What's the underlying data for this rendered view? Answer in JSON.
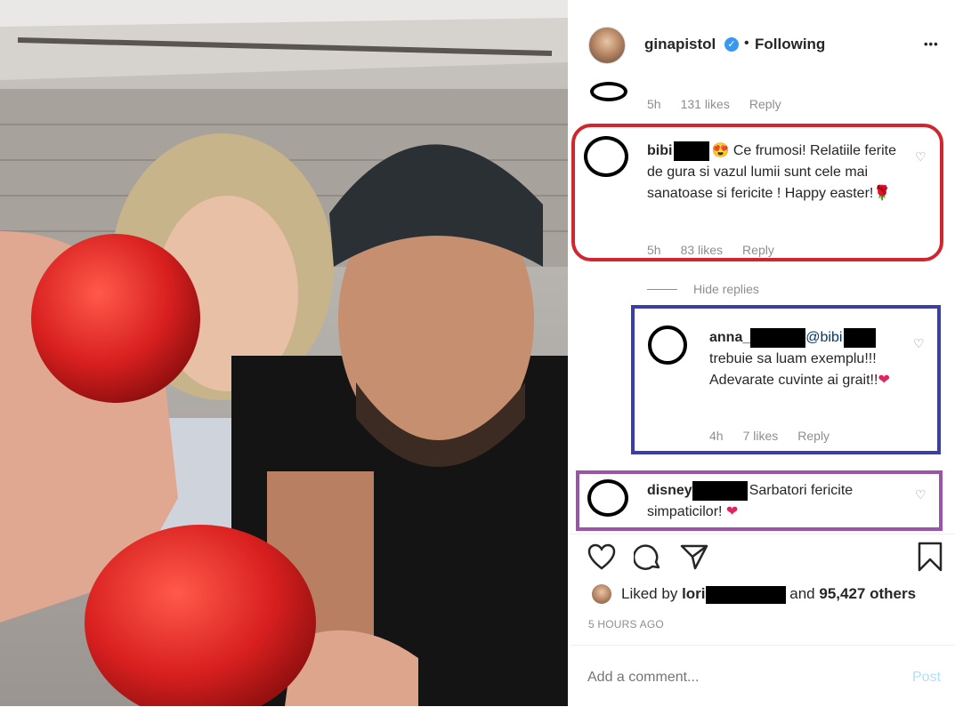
{
  "post": {
    "author": "ginapistol",
    "follow_status": "Following",
    "separator": "•",
    "more_label": "•••"
  },
  "top_comment_meta": {
    "time": "5h",
    "likes": "131 likes",
    "reply": "Reply"
  },
  "comments": [
    {
      "user": "bibi",
      "emoji": "😍",
      "text": "Ce frumosi! Relatiile ferite de gura si vazul lumii sunt cele mai sanatoase si fericite ! Happy easter!🌹",
      "time": "5h",
      "likes": "83 likes",
      "reply": "Reply",
      "highlight_color": "#d1262f"
    },
    {
      "user": "anna_",
      "mention": "@bibi",
      "text": "trebuie sa luam exemplu!!! Adevarate cuvinte ai grait!!",
      "time": "4h",
      "likes": "7 likes",
      "reply": "Reply",
      "highlight_color": "#3a3fa8"
    },
    {
      "user": "disney",
      "text": "Sarbatori fericite simpaticilor!",
      "highlight_color": "#9b55a8"
    }
  ],
  "hide_replies": "Hide replies",
  "likes_summary": {
    "prefix": "Liked by",
    "user": "lori",
    "and": "and",
    "count": "95,427 others"
  },
  "timestamp": "5 HOURS AGO",
  "comment_input": {
    "placeholder": "Add a comment...",
    "post_label": "Post"
  },
  "colors": {
    "verified": "#3897f0",
    "link": "#00376b",
    "post_disabled": "#b2dffc"
  }
}
